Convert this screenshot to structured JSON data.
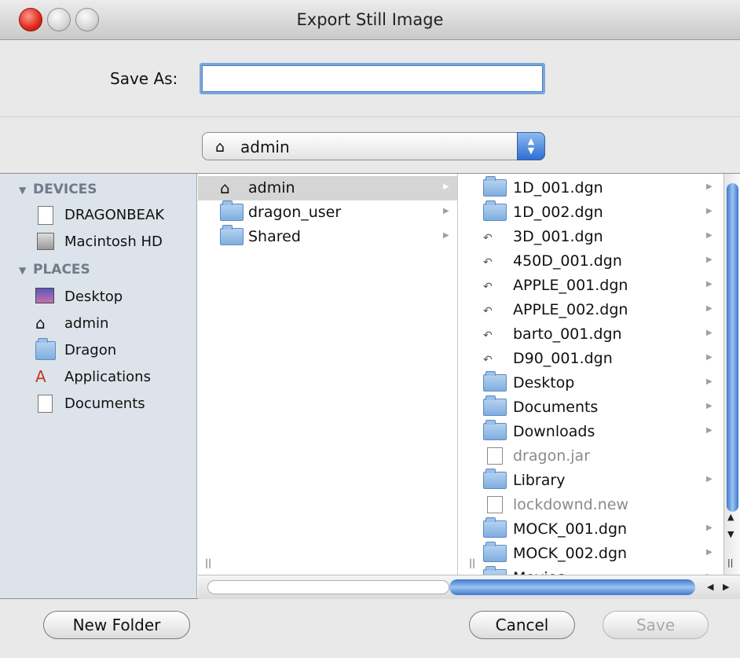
{
  "window": {
    "title": "Export Still Image"
  },
  "save_as": {
    "label": "Save As:",
    "value": "",
    "placeholder": ""
  },
  "location": {
    "current": "admin",
    "icon": "home-icon"
  },
  "sidebar": {
    "devices_header": "DEVICES",
    "places_header": "PLACES",
    "devices": [
      {
        "label": "DRAGONBEAK",
        "icon": "removable-disk-icon"
      },
      {
        "label": "Macintosh HD",
        "icon": "hard-disk-icon"
      }
    ],
    "places": [
      {
        "label": "Desktop",
        "icon": "desktop-icon"
      },
      {
        "label": "admin",
        "icon": "home-icon"
      },
      {
        "label": "Dragon",
        "icon": "folder-icon"
      },
      {
        "label": "Applications",
        "icon": "applications-icon"
      },
      {
        "label": "Documents",
        "icon": "documents-icon"
      }
    ]
  },
  "column1": [
    {
      "label": "admin",
      "icon": "home-icon",
      "selected": true
    },
    {
      "label": "dragon_user",
      "icon": "folder-icon"
    },
    {
      "label": "Shared",
      "icon": "folder-icon"
    }
  ],
  "column2": [
    {
      "label": "1D_001.dgn",
      "icon": "folder-icon"
    },
    {
      "label": "1D_002.dgn",
      "icon": "folder-icon"
    },
    {
      "label": "3D_001.dgn",
      "icon": "alias-icon"
    },
    {
      "label": "450D_001.dgn",
      "icon": "alias-icon"
    },
    {
      "label": "APPLE_001.dgn",
      "icon": "alias-icon"
    },
    {
      "label": "APPLE_002.dgn",
      "icon": "alias-icon"
    },
    {
      "label": "barto_001.dgn",
      "icon": "alias-icon"
    },
    {
      "label": "D90_001.dgn",
      "icon": "alias-icon"
    },
    {
      "label": "Desktop",
      "icon": "desktop-folder-icon"
    },
    {
      "label": "Documents",
      "icon": "documents-folder-icon"
    },
    {
      "label": "Downloads",
      "icon": "downloads-folder-icon"
    },
    {
      "label": "dragon.jar",
      "icon": "jar-file-icon",
      "disabled": true
    },
    {
      "label": "Library",
      "icon": "library-folder-icon"
    },
    {
      "label": "lockdownd.new",
      "icon": "document-icon",
      "disabled": true
    },
    {
      "label": "MOCK_001.dgn",
      "icon": "folder-icon"
    },
    {
      "label": "MOCK_002.dgn",
      "icon": "folder-icon"
    },
    {
      "label": "Movies",
      "icon": "movies-folder-icon"
    }
  ],
  "buttons": {
    "new_folder": "New Folder",
    "cancel": "Cancel",
    "save": "Save"
  }
}
